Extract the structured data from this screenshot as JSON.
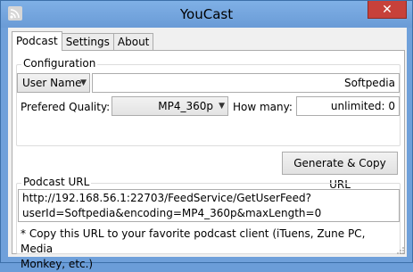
{
  "window": {
    "title": "YouCast",
    "close_symbol": "✕",
    "app_icon": "rss-icon"
  },
  "tabs": [
    {
      "label": "Podcast",
      "active": true
    },
    {
      "label": "Settings",
      "active": false
    },
    {
      "label": "About",
      "active": false
    }
  ],
  "configuration": {
    "group_title": "Configuration",
    "user_type": {
      "selected": "User Name"
    },
    "user_value": "Softpedia",
    "quality_label": "Prefered Quality:",
    "quality": {
      "selected": "MP4_360p"
    },
    "how_many_label": "How many:",
    "how_many_value": "unlimited: 0"
  },
  "generate_button": "Generate & Copy URL",
  "podcast_url": {
    "group_title": "Podcast URL",
    "line1": "http://192.168.56.1:22703/FeedService/GetUserFeed?",
    "line2": "userId=Softpedia&encoding=MP4_360p&maxLength=0"
  },
  "note": {
    "line1": "* Copy this URL to your favorite podcast client (iTuens, Zune PC, Media",
    "line2": "Monkey, etc.)"
  }
}
